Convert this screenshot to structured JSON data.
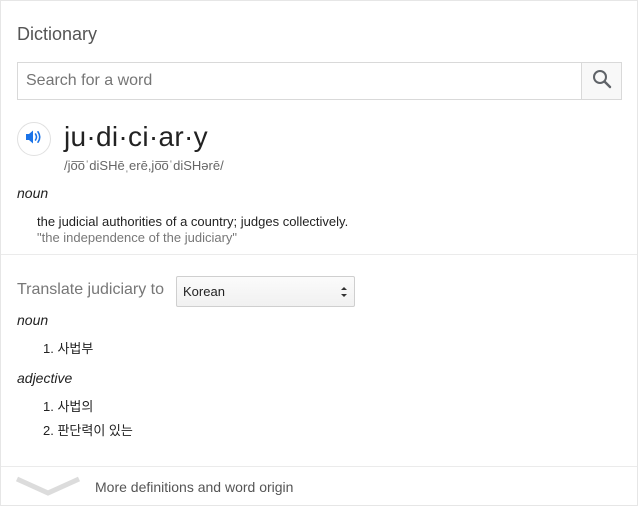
{
  "header": {
    "title": "Dictionary"
  },
  "search": {
    "placeholder": "Search for a word",
    "value": ""
  },
  "entry": {
    "headword": "ju·di·ci·ar·y",
    "phonetic": "/jo͞oˈdiSHēˌerē,jo͞oˈdiSHərē/",
    "senses": [
      {
        "pos": "noun",
        "definition": "the judicial authorities of a country; judges collectively.",
        "example": "\"the independence of the judiciary\""
      }
    ]
  },
  "translate": {
    "label": "Translate judiciary to",
    "selected_language": "Korean",
    "groups": [
      {
        "pos": "noun",
        "items": [
          "1. 사법부"
        ]
      },
      {
        "pos": "adjective",
        "items": [
          "1. 사법의",
          "2. 판단력이 있는"
        ]
      }
    ]
  },
  "footer": {
    "more_label": "More definitions and word origin"
  },
  "colors": {
    "accent_blue": "#1a73e8",
    "muted": "#777777"
  },
  "icons": {
    "search": "search-icon",
    "speaker": "speaker-icon",
    "expand": "chevron-down-icon",
    "select": "select-arrows-icon"
  }
}
